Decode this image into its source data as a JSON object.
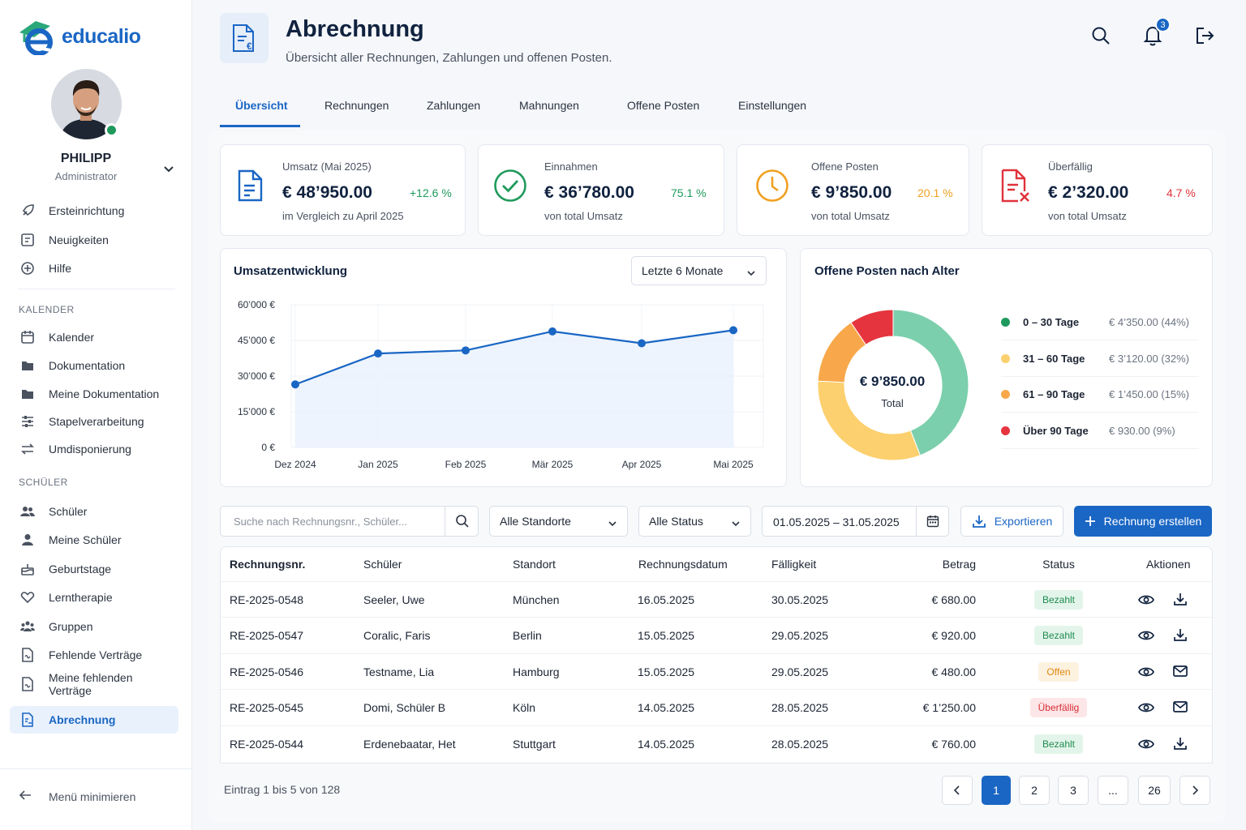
{
  "app": {
    "name": "educalio"
  },
  "user": {
    "name": "PHILIPP",
    "role": "Administrator"
  },
  "sidebar": {
    "top_items": [
      {
        "label": "Ersteinrichtung",
        "icon": "rocket-icon"
      },
      {
        "label": "Neuigkeiten",
        "icon": "news-icon"
      },
      {
        "label": "Hilfe",
        "icon": "help-circle-icon"
      }
    ],
    "section_calendar": "KALENDER",
    "calendar_items": [
      {
        "label": "Kalender",
        "icon": "calendar-icon"
      },
      {
        "label": "Dokumentation",
        "icon": "folder-icon"
      },
      {
        "label": "Meine Dokumentation",
        "icon": "folder-icon"
      },
      {
        "label": "Stapelverarbeitung",
        "icon": "sliders-icon"
      },
      {
        "label": "Umdisponierung",
        "icon": "swap-icon"
      }
    ],
    "section_students": "SCHÜLER",
    "student_items": [
      {
        "label": "Schüler",
        "icon": "users-icon"
      },
      {
        "label": "Meine Schüler",
        "icon": "user-icon"
      },
      {
        "label": "Geburtstage",
        "icon": "cake-icon"
      },
      {
        "label": "Lerntherapie",
        "icon": "heart-hand-icon"
      },
      {
        "label": "Gruppen",
        "icon": "group-icon"
      },
      {
        "label": "Fehlende Verträge",
        "icon": "contract-icon"
      },
      {
        "label": "Meine fehlenden Verträge",
        "icon": "contract-icon"
      }
    ],
    "active_item": {
      "label": "Abrechnung",
      "icon": "invoice-icon"
    },
    "minimize_label": "Menü minimieren"
  },
  "header": {
    "title": "Abrechnung",
    "subtitle": "Übersicht aller Rechnungen, Zahlungen und offenen Posten.",
    "notification_count": "3"
  },
  "tabs": [
    {
      "label": "Übersicht",
      "active": true
    },
    {
      "label": "Rechnungen"
    },
    {
      "label": "Zahlungen"
    },
    {
      "label": "Mahnungen"
    },
    {
      "label": "Offene Posten"
    },
    {
      "label": "Einstellungen"
    }
  ],
  "kpis": [
    {
      "label": "Umsatz (Mai 2025)",
      "value": "€ 48’950.00",
      "pct": "+12.6 %",
      "sub": "im Vergleich zu April 2025",
      "color": "#1f9a5c",
      "icon": "document-icon"
    },
    {
      "label": "Einnahmen",
      "value": "€ 36’780.00",
      "pct": "75.1 %",
      "sub": "von total Umsatz",
      "color": "#1f9a5c",
      "icon": "check-circle-icon"
    },
    {
      "label": "Offene Posten",
      "value": "€ 9’850.00",
      "pct": "20.1 %",
      "sub": "von total Umsatz",
      "color": "#f0a020",
      "icon": "clock-icon"
    },
    {
      "label": "Überfällig",
      "value": "€ 2’320.00",
      "pct": "4.7 %",
      "sub": "von total Umsatz",
      "color": "#e0323c",
      "icon": "document-x-icon"
    }
  ],
  "revenue_chart": {
    "title": "Umsatzentwicklung",
    "range_select": "Letzte 6 Monate",
    "chart_data": {
      "type": "line",
      "x": [
        "Dez 2024",
        "Jan 2025",
        "Feb 2025",
        "Mär 2025",
        "Apr 2025",
        "Mai 2025"
      ],
      "values": [
        26500,
        39500,
        40800,
        48800,
        43800,
        49300
      ],
      "ylim": [
        0,
        60000
      ],
      "yticks": [
        0,
        15000,
        30000,
        45000,
        60000
      ],
      "ytick_labels": [
        "0 €",
        "15’000 €",
        "30’000 €",
        "45’000 €",
        "60’000 €"
      ],
      "color": "#1a66c4",
      "grid": true
    }
  },
  "aging_chart": {
    "title": "Offene Posten nach Alter",
    "center_value": "€ 9’850.00",
    "center_label": "Total",
    "chart_data": {
      "type": "pie",
      "categories": [
        "0 – 30 Tage",
        "31 – 60 Tage",
        "61 – 90 Tage",
        "Über 90 Tage"
      ],
      "values": [
        4350,
        3120,
        1450,
        930
      ],
      "value_labels": [
        "€ 4’350.00 (44%)",
        "€ 3’120.00  (32%)",
        "€ 1’450.00 (15%)",
        "€ 930.00 (9%)"
      ],
      "colors": [
        "#7ccfac",
        "#fcd06e",
        "#f8a84a",
        "#e5343e"
      ]
    }
  },
  "filters": {
    "search_placeholder": "Suche nach Rechnungsnr., Schüler...",
    "location": "Alle Standorte",
    "status": "Alle Status",
    "date_range": "01.05.2025 – 31.05.2025",
    "export_label": "Exportieren",
    "create_label": "Rechnung erstellen"
  },
  "table": {
    "headers": [
      "Rechnungsnr.",
      "Schüler",
      "Standort",
      "Rechnungsdatum",
      "Fälligkeit",
      "Betrag",
      "Status",
      "Aktionen"
    ],
    "rows": [
      {
        "nr": "RE-2025-0548",
        "student": "Seeler, Uwe",
        "location": "München",
        "date": "16.05.2025",
        "due": "30.05.2025",
        "amount": "€ 680.00",
        "status": "Bezahlt",
        "kind": "paid",
        "action": "download-icon"
      },
      {
        "nr": "RE-2025-0547",
        "student": "Coralic, Faris",
        "location": "Berlin",
        "date": "15.05.2025",
        "due": "29.05.2025",
        "amount": "€ 920.00",
        "status": "Bezahlt",
        "kind": "paid",
        "action": "download-icon"
      },
      {
        "nr": "RE-2025-0546",
        "student": "Testname, Lia",
        "location": "Hamburg",
        "date": "15.05.2025",
        "due": "29.05.2025",
        "amount": "€ 480.00",
        "status": "Offen",
        "kind": "open",
        "action": "mail-icon"
      },
      {
        "nr": "RE-2025-0545",
        "student": "Domi, Schüler B",
        "location": "Köln",
        "date": "14.05.2025",
        "due": "28.05.2025",
        "amount": "€ 1’250.00",
        "status": "Überfällig",
        "kind": "overdue",
        "action": "mail-icon"
      },
      {
        "nr": "RE-2025-0544",
        "student": "Erdenebaatar, Het",
        "location": "Stuttgart",
        "date": "14.05.2025",
        "due": "28.05.2025",
        "amount": "€ 760.00",
        "status": "Bezahlt",
        "kind": "paid",
        "action": "download-icon"
      }
    ],
    "status_colors": {
      "paid": {
        "bg": "#e3f5ea",
        "fg": "#1f8a52"
      },
      "open": {
        "bg": "#fdf1e0",
        "fg": "#e28a12"
      },
      "overdue": {
        "bg": "#fde6e7",
        "fg": "#d92d36"
      }
    }
  },
  "pagination": {
    "info": "Eintrag 1 bis 5 von 128",
    "pages": [
      "1",
      "2",
      "3",
      "...",
      "26"
    ],
    "active": "1"
  }
}
